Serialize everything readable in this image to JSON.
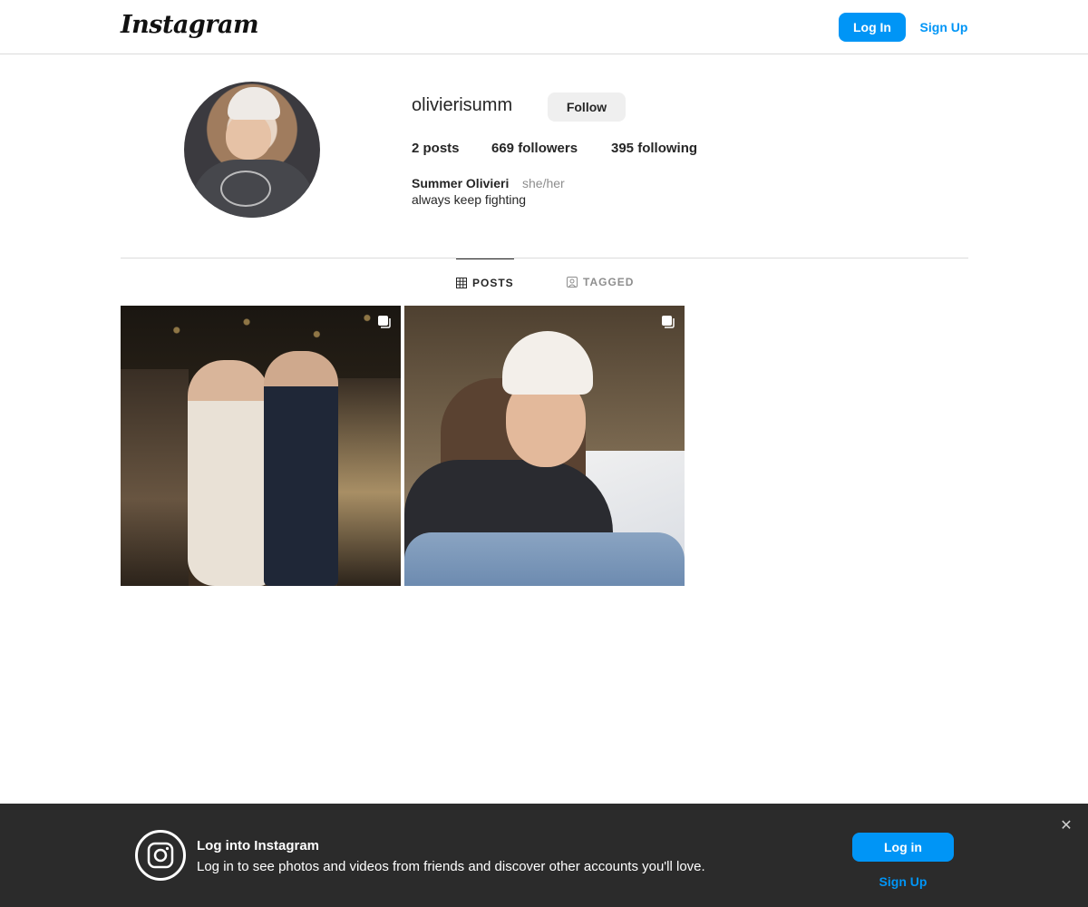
{
  "nav": {
    "logo_text": "Instagram",
    "login_label": "Log In",
    "signup_label": "Sign Up"
  },
  "profile": {
    "username": "olivierisumm",
    "follow_label": "Follow",
    "stats": {
      "posts_count": "2",
      "posts_label": " posts",
      "followers_count": "669",
      "followers_label": " followers",
      "following_count": "395",
      "following_label": " following"
    },
    "full_name": "Summer Olivieri",
    "pronouns": "she/her",
    "bio": "always keep fighting"
  },
  "tabs": [
    {
      "label": "POSTS",
      "icon": "grid-icon",
      "active": true
    },
    {
      "label": "TAGGED",
      "icon": "tagged-icon",
      "active": false
    }
  ],
  "posts": [
    {
      "icon": "multiple-photos-icon"
    },
    {
      "icon": "multiple-photos-icon"
    }
  ],
  "banner": {
    "icon": "instagram-icon",
    "title": "Log into Instagram",
    "text": "Log in to see photos and videos from friends and discover other accounts you'll love.",
    "login_label": "Log in",
    "signup_label": "Sign Up",
    "close_icon": "close-icon"
  },
  "colors": {
    "accent": "#0095f6",
    "banner_bg": "#2b2b2b",
    "secondary_text": "#8e8e8e"
  }
}
